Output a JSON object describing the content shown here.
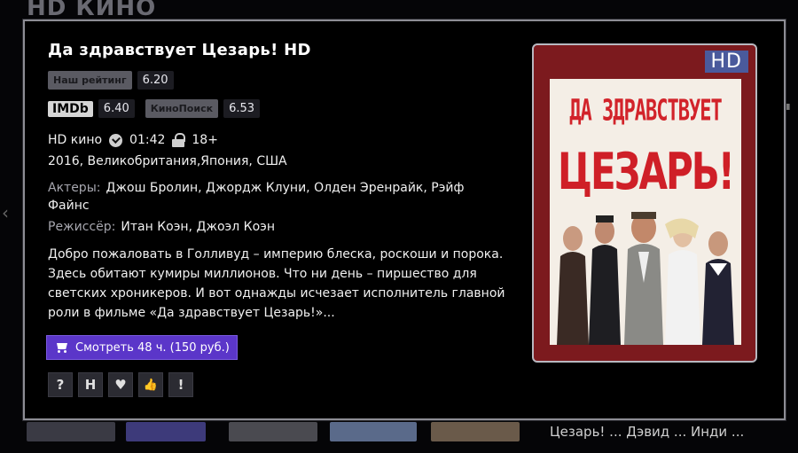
{
  "background": {
    "title": "HD КИНО",
    "caption": "Цезарь! ... Дэвид ... Инди ... "
  },
  "movie": {
    "title": "Да здравствует Цезарь! HD",
    "ratings": {
      "ours_label": "Наш рейтинг",
      "ours_value": "6.20",
      "imdb_label": "IMDb",
      "imdb_value": "6.40",
      "kp_label": "КиноПоиск",
      "kp_value": "6.53"
    },
    "section": "HD кино",
    "duration": "01:42",
    "age": "18+",
    "year_country": "2016, Великобритания,Япония, США",
    "actors_label": "Актеры:",
    "actors": "Джош Бролин, Джордж Клуни, Олден Эренрайк, Рэйф Файнс",
    "director_label": "Режиссёр:",
    "director": "Итан Коэн, Джоэл Коэн",
    "description": "Добро пожаловать в Голливуд – империю блеска, роскоши и порока. Здесь обитают кумиры миллионов. Что ни день – пиршество для светских хроникеров. И вот однажды исчезает исполнитель главной роли в фильме «Да здравствует Цезарь!»...",
    "watch_button": "Смотреть 48 ч. (150 руб.)",
    "actions": {
      "help": "?",
      "trailer": "H",
      "favorite": "♥",
      "like": "👍",
      "report": "!"
    },
    "poster": {
      "hd_badge": "HD",
      "line1": "ДА ЗДРАВСТВУЕТ",
      "line2": "ЦЕЗАРЬ!"
    }
  },
  "colors": {
    "accent_purple": "#5b36c9",
    "poster_red": "#7c1a1e",
    "title_red": "#cf1f27"
  }
}
